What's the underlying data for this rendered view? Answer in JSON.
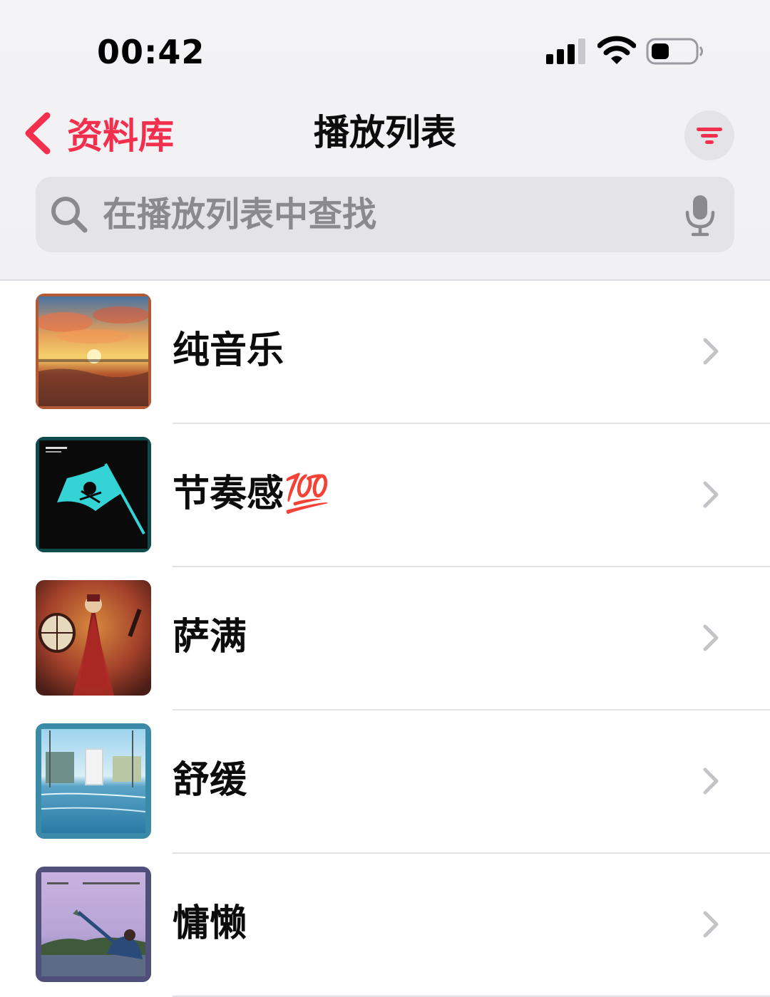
{
  "status_bar": {
    "time": "00:42",
    "signal_icon": "cellular-signal-icon",
    "wifi_icon": "wifi-icon",
    "battery_icon": "battery-icon"
  },
  "nav": {
    "back_label": "资料库",
    "title": "播放列表",
    "filter_icon": "filter-icon"
  },
  "search": {
    "placeholder": "在播放列表中查找",
    "mic_icon": "microphone-icon"
  },
  "colors": {
    "accent": "#f2304e",
    "background": "#ffffff",
    "header_background": "#f2f2f4",
    "search_background": "#e4e4e8",
    "chevron": "#c4c4c8"
  },
  "playlists": [
    {
      "name": "纯音乐",
      "artwork": "sunset-painting-artwork"
    },
    {
      "name": "节奏感💯",
      "artwork": "pirate-flag-artwork"
    },
    {
      "name": "萨满",
      "artwork": "shaman-drum-artwork"
    },
    {
      "name": "舒缓",
      "artwork": "flooded-town-artwork"
    },
    {
      "name": "慵懒",
      "artwork": "lakeside-kite-artwork"
    }
  ]
}
